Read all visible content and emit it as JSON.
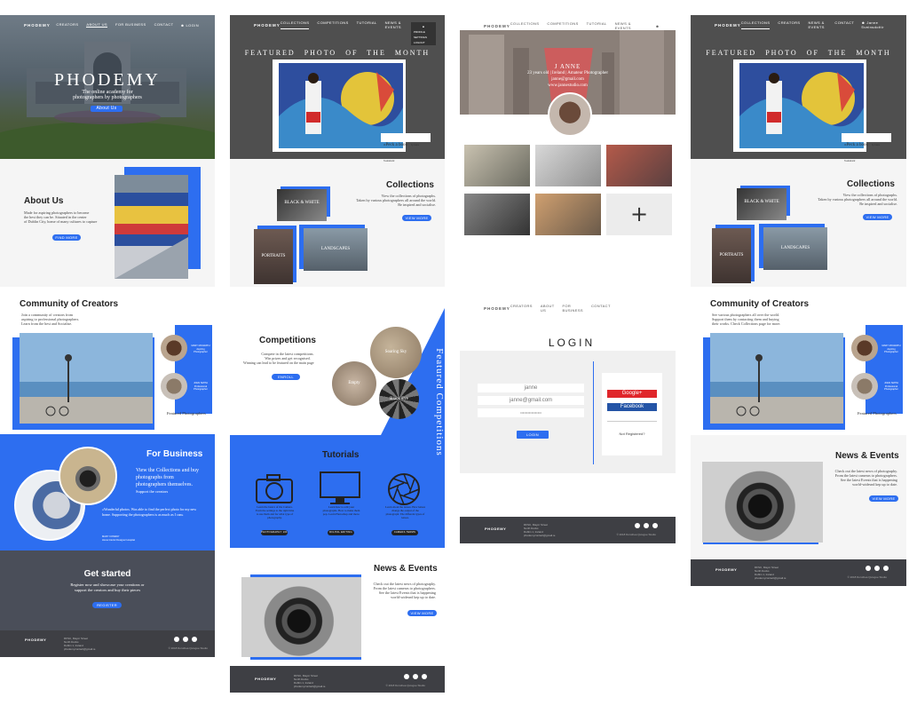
{
  "site": {
    "logo": "PHODEMY",
    "nav": [
      "CREATORS",
      "ABOUT US",
      "FOR BUSINESS",
      "CONTACT"
    ],
    "nav_b": [
      "COLLECTIONS",
      "COMPETITIONS",
      "TUTORIAL",
      "NEWS & EVENTS"
    ],
    "nav_d": [
      "COLLECTIONS",
      "CREATORS",
      "NEWS & EVENTS",
      "CONTACT"
    ],
    "login": "LOGIN",
    "user_name": "Janne Sveinsdottir"
  },
  "hero": {
    "title": "PHODEMY",
    "subtitle_1": "The online academy for",
    "subtitle_2": "photographers by photographers",
    "button": "About Us"
  },
  "about": {
    "title": "About Us",
    "text": [
      "Made for aspiring photographers to become",
      "the best they can be. Situated in the center",
      "of Dublin City, home of many cultures to capture"
    ],
    "button": "FIND MORE"
  },
  "featured": {
    "title": "FEATURED PHOTO OF THE MONTH",
    "caption": "«Peck a boo»",
    "by": "by Janne Sveinsdottir"
  },
  "user_menu": [
    "PROFILE",
    "SETTINGS",
    "LOGOUT"
  ],
  "collections": {
    "title": "Collections",
    "text": [
      "View the collections of photographs.",
      "Taken by various photographers all around the world.",
      "Be inspired and socialise."
    ],
    "button": "VIEW MORE",
    "tiles": [
      "BLACK & WHITE",
      "PORTRAITS",
      "LANDSCAPES"
    ]
  },
  "profile": {
    "name": "J ANNE",
    "details": "23 years old | Ireland | Amateur Photographer",
    "email": "janne@gmail.com",
    "site": "www.jannestudio.com"
  },
  "community": {
    "title": "Community of Creators",
    "text_a": [
      "Join a community of creators from",
      "aspiring to professional photographers.",
      "Learn from the best and Socialise."
    ],
    "text_b": [
      "See various photographers all over the world.",
      "Support them by contacting them and buying",
      "their works. Check Collections page for more."
    ],
    "creator1_name": "MARY MCGRATH",
    "creator1_role": "Aspiring Photographer",
    "creator2_name": "JOHN SMITH",
    "creator2_role": "Professional Photographer",
    "label": "Featured Photographers"
  },
  "competitions": {
    "title": "Competitions",
    "text": [
      "Compete in the latest competitions.",
      "Win prizes and get recognised.",
      "Winning can lead to be featured on the main page"
    ],
    "button": "ENROLL",
    "side_title": "Featured Competitions",
    "circles": [
      "Soaring Sky",
      "Empty",
      "Black Eye"
    ]
  },
  "tutorials": {
    "title": "Tutorials",
    "items": [
      {
        "text": "Learn the basics of the Camera. From the settings to the right time to use them and for what type of photography.",
        "button": "PHOTOGRAPHY 101"
      },
      {
        "text": "Learn how to edit your photographs. How to make them pop. Learn Photoshop and more.",
        "button": "DIGITAL EDITING"
      },
      {
        "text": "Learn about the lenses. How lenses change the output of the photograph. The different types of lenses.",
        "button": "CAMERA TERMS"
      }
    ]
  },
  "business": {
    "title": "For Business",
    "text": [
      "View the Collections and buy",
      "photographs from",
      "photographers themselves.",
      "Support the creators"
    ],
    "quote": "«Wonderful photos. Was able to find the perfect photo for my new home. Supporting the photographers is as much as I can»",
    "quote_by": "MARY CONWAY",
    "quote_role": "Home Interior Designer Hospital"
  },
  "get_started": {
    "title": "Get started",
    "text": [
      "Register now and showcase your creations or",
      "support the creators and buy their pieces"
    ],
    "button": "REGISTER"
  },
  "news": {
    "title": "News & Events",
    "text": [
      "Check out the latest news of photography.",
      "From the latest cameras to photographers.",
      "See the latest Events that is happening",
      "world-widesnd kep up to date."
    ],
    "button": "VIEW MORE"
  },
  "login_page": {
    "title": "LOGIN",
    "username": "janne",
    "email": "janne@gmail.com",
    "password": "•••••••••••••••••",
    "button": "LOGIN",
    "google": "Google+",
    "facebook": "Facebook",
    "register": "Not Registered?"
  },
  "footer": {
    "line1": "DFSC, Mayor Street",
    "line2": "North Docks",
    "line3": "Dublin 1, Ireland",
    "line4": "phodemycontact@gmail.ie",
    "copyright": "© 2018 Dorothea Quiogue Studio"
  },
  "colors": {
    "accent": "#2d6ef0",
    "dark": "#3e3f44",
    "gray_header": "#4f4f4f"
  }
}
